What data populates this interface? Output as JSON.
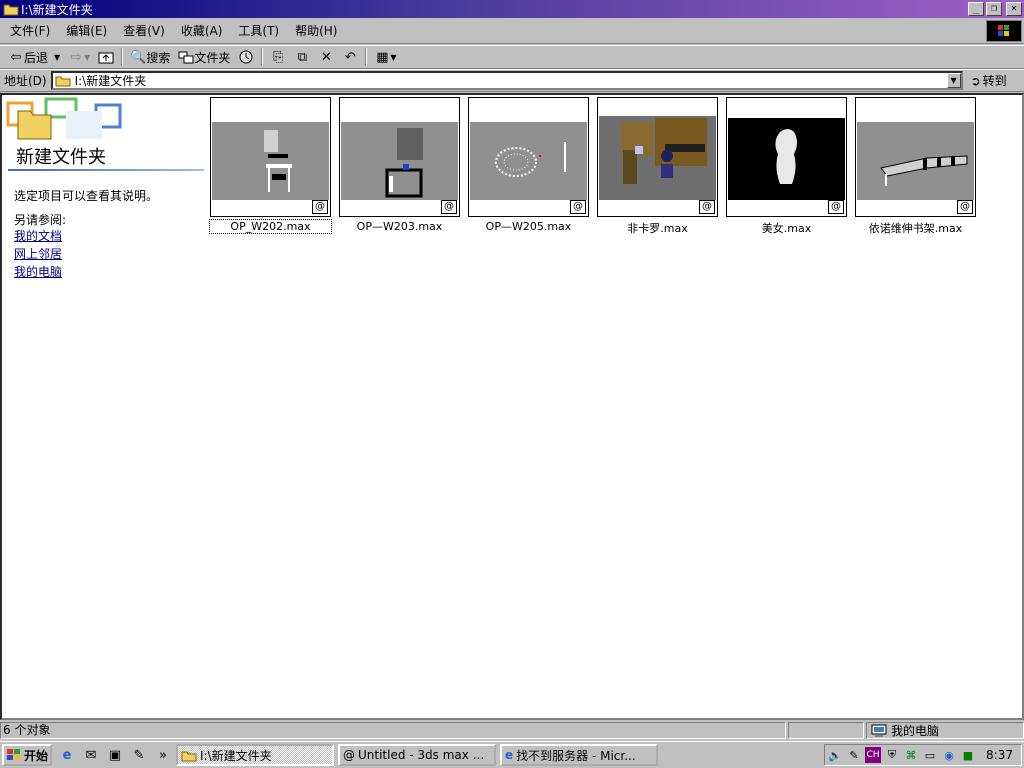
{
  "window": {
    "title": "I:\\新建文件夹"
  },
  "menu": [
    "文件(F)",
    "编辑(E)",
    "查看(V)",
    "收藏(A)",
    "工具(T)",
    "帮助(H)"
  ],
  "toolbar": {
    "back": "后退",
    "search": "搜索",
    "folders": "文件夹"
  },
  "address": {
    "label": "地址(D)",
    "value": "I:\\新建文件夹",
    "go": "转到"
  },
  "left_panel": {
    "folder_title": "新建文件夹",
    "description": "选定项目可以查看其说明。",
    "see_also": "另请参阅:",
    "links": [
      "我的文档",
      "网上邻居",
      "我的电脑"
    ]
  },
  "files": [
    {
      "name": "OP_W202.max",
      "selected": true
    },
    {
      "name": "OP—W203.max",
      "selected": false
    },
    {
      "name": "OP—W205.max",
      "selected": false
    },
    {
      "name": "非卡罗.max",
      "selected": false
    },
    {
      "name": "美女.max",
      "selected": false
    },
    {
      "name": "依诺维伸书架.max",
      "selected": false
    }
  ],
  "status": {
    "count": "6 个对象",
    "location": "我的电脑"
  },
  "taskbar": {
    "start": "开始",
    "tasks": [
      "I:\\新建文件夹",
      "Untitled - 3ds max ...",
      "找不到服务器 - Micr..."
    ],
    "clock": "8:37"
  },
  "colors": {
    "title_start": "#000080",
    "title_end": "#a05fc8",
    "link": "#000080"
  }
}
